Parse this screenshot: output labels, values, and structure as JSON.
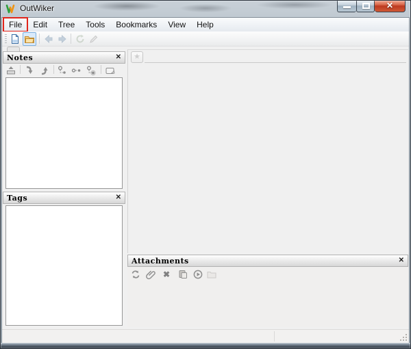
{
  "window": {
    "title": "OutWiker",
    "controls": {
      "close_glyph": "✕"
    }
  },
  "annotation": {
    "highlight_color": "#e1241a",
    "target_menu": "File"
  },
  "menu": {
    "items": [
      {
        "label": "File"
      },
      {
        "label": "Edit"
      },
      {
        "label": "Tree"
      },
      {
        "label": "Tools"
      },
      {
        "label": "Bookmarks"
      },
      {
        "label": "View"
      },
      {
        "label": "Help"
      }
    ]
  },
  "main_toolbar": {
    "icons": [
      {
        "name": "new-page-icon"
      },
      {
        "name": "open-tree-icon",
        "state": "hovered"
      },
      {
        "name": "back-icon",
        "state": "disabled"
      },
      {
        "name": "forward-icon",
        "state": "disabled"
      },
      {
        "name": "reload-icon",
        "state": "disabled"
      },
      {
        "name": "edit-icon",
        "state": "disabled"
      }
    ]
  },
  "notes_panel": {
    "title": "Notes",
    "close_glyph": "✕",
    "icons": [
      {
        "name": "goto-parent-page-icon"
      },
      {
        "name": "move-page-down-icon"
      },
      {
        "name": "move-page-up-icon"
      },
      {
        "name": "collapse-tree-icon"
      },
      {
        "name": "expand-siblings-icon"
      },
      {
        "name": "expand-tree-icon"
      },
      {
        "name": "rename-page-icon"
      }
    ]
  },
  "tags_panel": {
    "title": "Tags",
    "close_glyph": "✕"
  },
  "main_area": {
    "bookmark_glyph": "★"
  },
  "attachments_panel": {
    "title": "Attachments",
    "close_glyph": "✕",
    "delete_glyph": "✖",
    "icons": [
      {
        "name": "refresh-attachments-icon"
      },
      {
        "name": "attach-file-icon"
      },
      {
        "name": "delete-attachment-icon"
      },
      {
        "name": "paste-attachment-icon"
      },
      {
        "name": "execute-attachment-icon"
      },
      {
        "name": "open-attachments-folder-icon"
      }
    ]
  },
  "statusbar": {
    "left_text": "",
    "right_text": ""
  }
}
